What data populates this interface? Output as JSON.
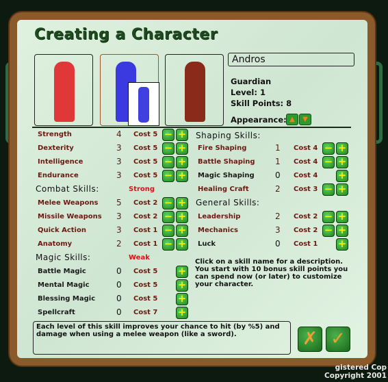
{
  "title": "Creating a Character",
  "character": {
    "name": "Andros",
    "class": "Guardian",
    "level": "Level: 1",
    "skill_points": "Skill Points: 8",
    "appearance_label": "Appearance:"
  },
  "attributes": [
    {
      "name": "Strength",
      "value": "4",
      "cost": "Cost 5",
      "minus": true
    },
    {
      "name": "Dexterity",
      "value": "3",
      "cost": "Cost 5",
      "minus": true
    },
    {
      "name": "Intelligence",
      "value": "3",
      "cost": "Cost 5",
      "minus": true
    },
    {
      "name": "Endurance",
      "value": "3",
      "cost": "Cost 5",
      "minus": true
    }
  ],
  "combat": {
    "header": "Combat Skills:",
    "tag": "Strong",
    "skills": [
      {
        "name": "Melee Weapons",
        "value": "5",
        "cost": "Cost 2",
        "minus": true
      },
      {
        "name": "Missile Weapons",
        "value": "3",
        "cost": "Cost 2",
        "minus": true
      },
      {
        "name": "Quick Action",
        "value": "3",
        "cost": "Cost 1",
        "minus": true
      },
      {
        "name": "Anatomy",
        "value": "2",
        "cost": "Cost 1",
        "minus": true
      }
    ]
  },
  "magic": {
    "header": "Magic Skills:",
    "tag": "Weak",
    "skills": [
      {
        "name": "Battle Magic",
        "value": "0",
        "cost": "Cost 5",
        "minus": false
      },
      {
        "name": "Mental Magic",
        "value": "0",
        "cost": "Cost 5",
        "minus": false
      },
      {
        "name": "Blessing Magic",
        "value": "0",
        "cost": "Cost 5",
        "minus": false
      },
      {
        "name": "Spellcraft",
        "value": "0",
        "cost": "Cost 7",
        "minus": false
      }
    ]
  },
  "shaping": {
    "header": "Shaping Skills:",
    "skills": [
      {
        "name": "Fire Shaping",
        "value": "1",
        "cost": "Cost 4",
        "minus": true
      },
      {
        "name": "Battle Shaping",
        "value": "1",
        "cost": "Cost 4",
        "minus": true
      },
      {
        "name": "Magic Shaping",
        "value": "0",
        "cost": "Cost 4",
        "minus": false
      },
      {
        "name": "Healing Craft",
        "value": "2",
        "cost": "Cost 3",
        "minus": true
      }
    ]
  },
  "general": {
    "header": "General Skills:",
    "skills": [
      {
        "name": "Leadership",
        "value": "2",
        "cost": "Cost 2",
        "minus": true
      },
      {
        "name": "Mechanics",
        "value": "3",
        "cost": "Cost 2",
        "minus": true
      },
      {
        "name": "Luck",
        "value": "0",
        "cost": "Cost 1",
        "minus": false
      }
    ]
  },
  "help_text": "Click on a skill name for a description. You start with 10 bonus skill points you can spend now (or later) to customize your character.",
  "description": "Each level of this skill improves your chance to hit (by %5) and damage when using a melee weapon (like a sword).",
  "buttons": {
    "cancel": "✗",
    "ok": "✓",
    "up": "▲",
    "down": "▼",
    "minus": "−",
    "plus": "+"
  },
  "copyright": {
    "line1": "gistered Cop",
    "line2": "Copyright 2001"
  }
}
